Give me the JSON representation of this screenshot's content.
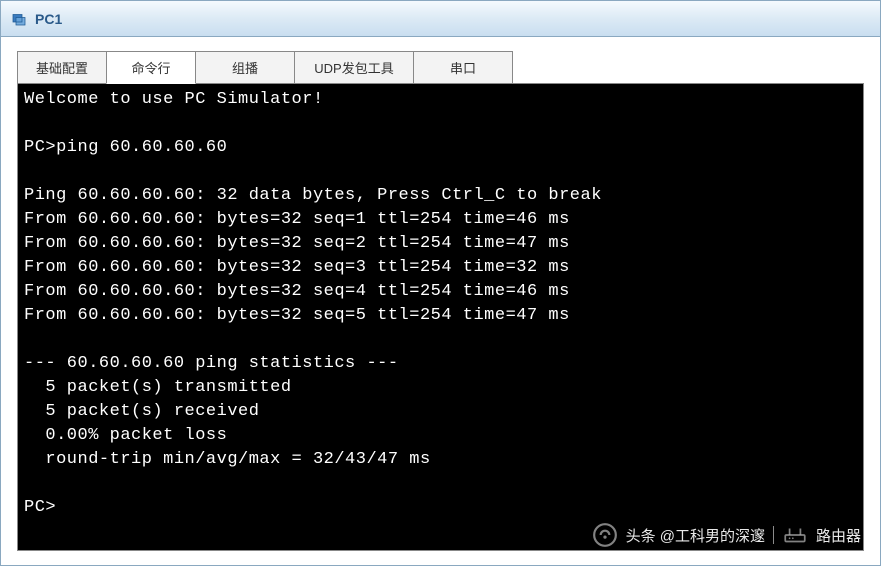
{
  "window": {
    "title": "PC1"
  },
  "tabs": [
    {
      "label": "基础配置"
    },
    {
      "label": "命令行"
    },
    {
      "label": "组播"
    },
    {
      "label": "UDP发包工具"
    },
    {
      "label": "串口"
    }
  ],
  "terminal": {
    "welcome": "Welcome to use PC Simulator!",
    "prompt1": "PC>ping 60.60.60.60",
    "ping_header": "Ping 60.60.60.60: 32 data bytes, Press Ctrl_C to break",
    "replies": [
      "From 60.60.60.60: bytes=32 seq=1 ttl=254 time=46 ms",
      "From 60.60.60.60: bytes=32 seq=2 ttl=254 time=47 ms",
      "From 60.60.60.60: bytes=32 seq=3 ttl=254 time=32 ms",
      "From 60.60.60.60: bytes=32 seq=4 ttl=254 time=46 ms",
      "From 60.60.60.60: bytes=32 seq=5 ttl=254 time=47 ms"
    ],
    "stats_header": "--- 60.60.60.60 ping statistics ---",
    "stats_tx": "  5 packet(s) transmitted",
    "stats_rx": "  5 packet(s) received",
    "stats_loss": "  0.00% packet loss",
    "stats_rtt": "  round-trip min/avg/max = 32/43/47 ms",
    "prompt2": "PC>"
  },
  "watermark": {
    "left": "头条 @工科男的深邃",
    "right": "路由器"
  }
}
